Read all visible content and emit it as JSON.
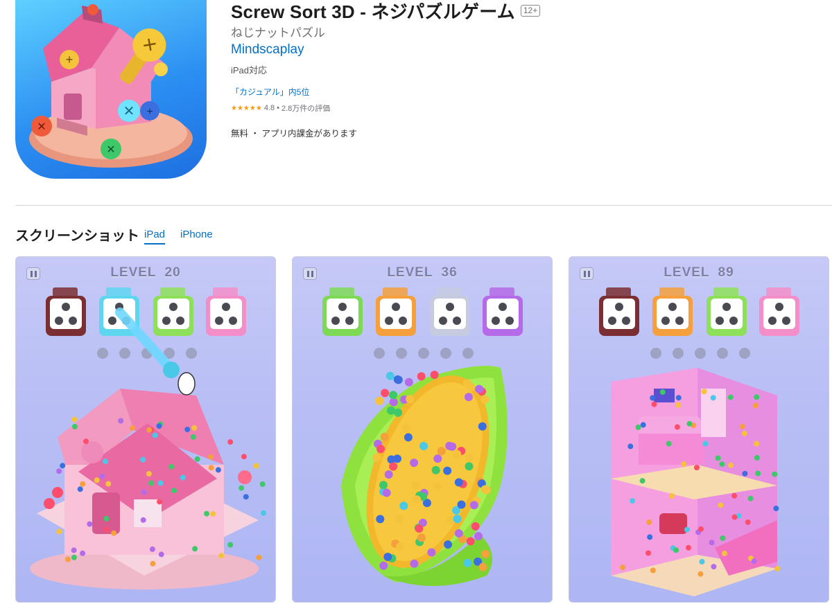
{
  "app": {
    "title": "Screw Sort 3D - ネジパズルゲーム",
    "age_rating": "12+",
    "subtitle": "ねじナットパズル",
    "developer": "Mindscaplay",
    "device_support": "iPad対応",
    "category_rank": "「カジュアル」内5位",
    "stars": "★★★★★",
    "rating": "4.8",
    "rating_separator": "•",
    "rating_count": "2.8万件の評価",
    "price_info": "無料 ・ アプリ内課金があります"
  },
  "screenshots": {
    "heading": "スクリーンショット",
    "tabs": [
      {
        "label": "iPad",
        "selected": true
      },
      {
        "label": "iPhone",
        "selected": false
      }
    ],
    "items": [
      {
        "level_label": "LEVEL",
        "level_number": "20",
        "scene": "house",
        "box_colors": [
          "#7b2f33",
          "#5fd6f0",
          "#8ee05a",
          "#f38ec8"
        ]
      },
      {
        "level_label": "LEVEL",
        "level_number": "36",
        "scene": "corn",
        "box_colors": [
          "#7ed957",
          "#f5a03c",
          "#c7cbe0",
          "#b56be8"
        ]
      },
      {
        "level_label": "LEVEL",
        "level_number": "89",
        "scene": "room",
        "box_colors": [
          "#7b2f33",
          "#f5a03c",
          "#8ee05a",
          "#f38ec8"
        ]
      }
    ]
  },
  "colors": {
    "link": "#0070c9",
    "star": "#f39c12"
  }
}
